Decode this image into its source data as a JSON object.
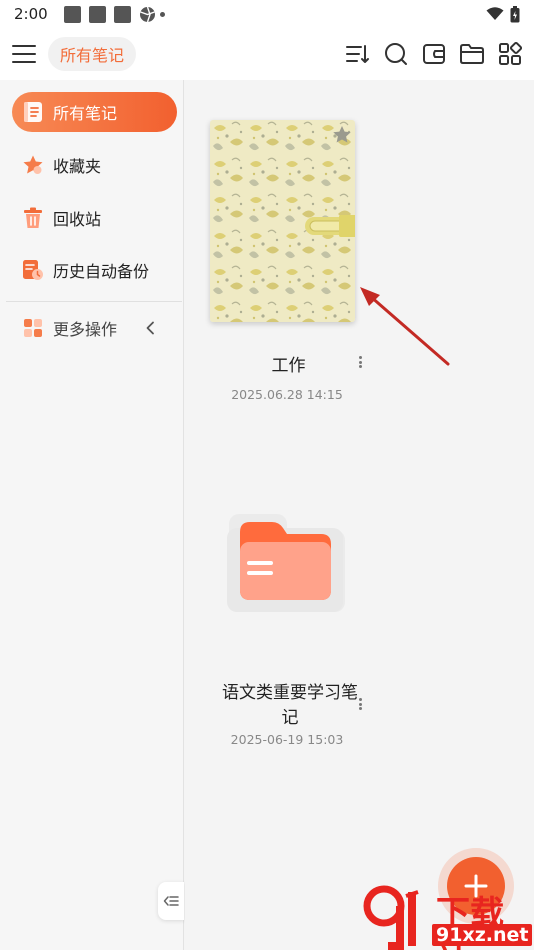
{
  "status_bar": {
    "time": "2:00"
  },
  "toolbar": {
    "chip_label": "所有笔记",
    "icons": [
      "sort-icon",
      "search-icon",
      "wallet-icon",
      "folder-icon",
      "grid-icon"
    ]
  },
  "sidebar": {
    "items": [
      {
        "label": "所有笔记",
        "icon": "notes-icon",
        "active": true
      },
      {
        "label": "收藏夹",
        "icon": "star-icon",
        "active": false
      },
      {
        "label": "回收站",
        "icon": "trash-icon",
        "active": false
      },
      {
        "label": "历史自动备份",
        "icon": "backup-icon",
        "active": false
      }
    ],
    "more": {
      "label": "更多操作",
      "icon": "apps-icon"
    }
  },
  "notes": [
    {
      "title": "工作",
      "date": "2025.06.28 14:15",
      "type": "notebook",
      "starred": true
    },
    {
      "title": "语文类重要学习笔记",
      "date": "2025-06-19 15:03",
      "type": "folder"
    }
  ],
  "watermark": {
    "text": "下载站",
    "url": "91xz.net"
  },
  "colors": {
    "accent": "#f2602f",
    "accent_light": "#f78a55",
    "folder": "#ffa28a"
  }
}
